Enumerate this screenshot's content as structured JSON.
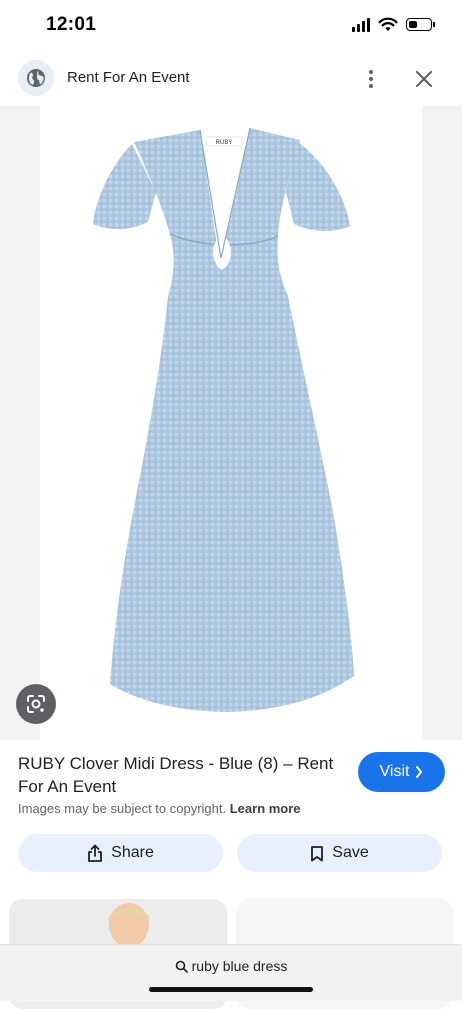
{
  "status_bar": {
    "time": "12:01",
    "battery_level": 0.35
  },
  "header": {
    "title": "Rent For An Event"
  },
  "image": {
    "brand_tag": "RUBY"
  },
  "product": {
    "title": "RUBY Clover Midi Dress - Blue (8) – Rent For An Event",
    "visit_label": "Visit",
    "copyright_text": "Images may be subject to copyright.",
    "learn_more": "Learn more"
  },
  "actions": {
    "share_label": "Share",
    "save_label": "Save"
  },
  "search": {
    "query": "ruby blue dress"
  },
  "colors": {
    "accent": "#1a73e8",
    "pill_bg": "#e8f0fe",
    "dress_blue": "#a9c4dc",
    "image_bg": "#f1f3f4"
  }
}
